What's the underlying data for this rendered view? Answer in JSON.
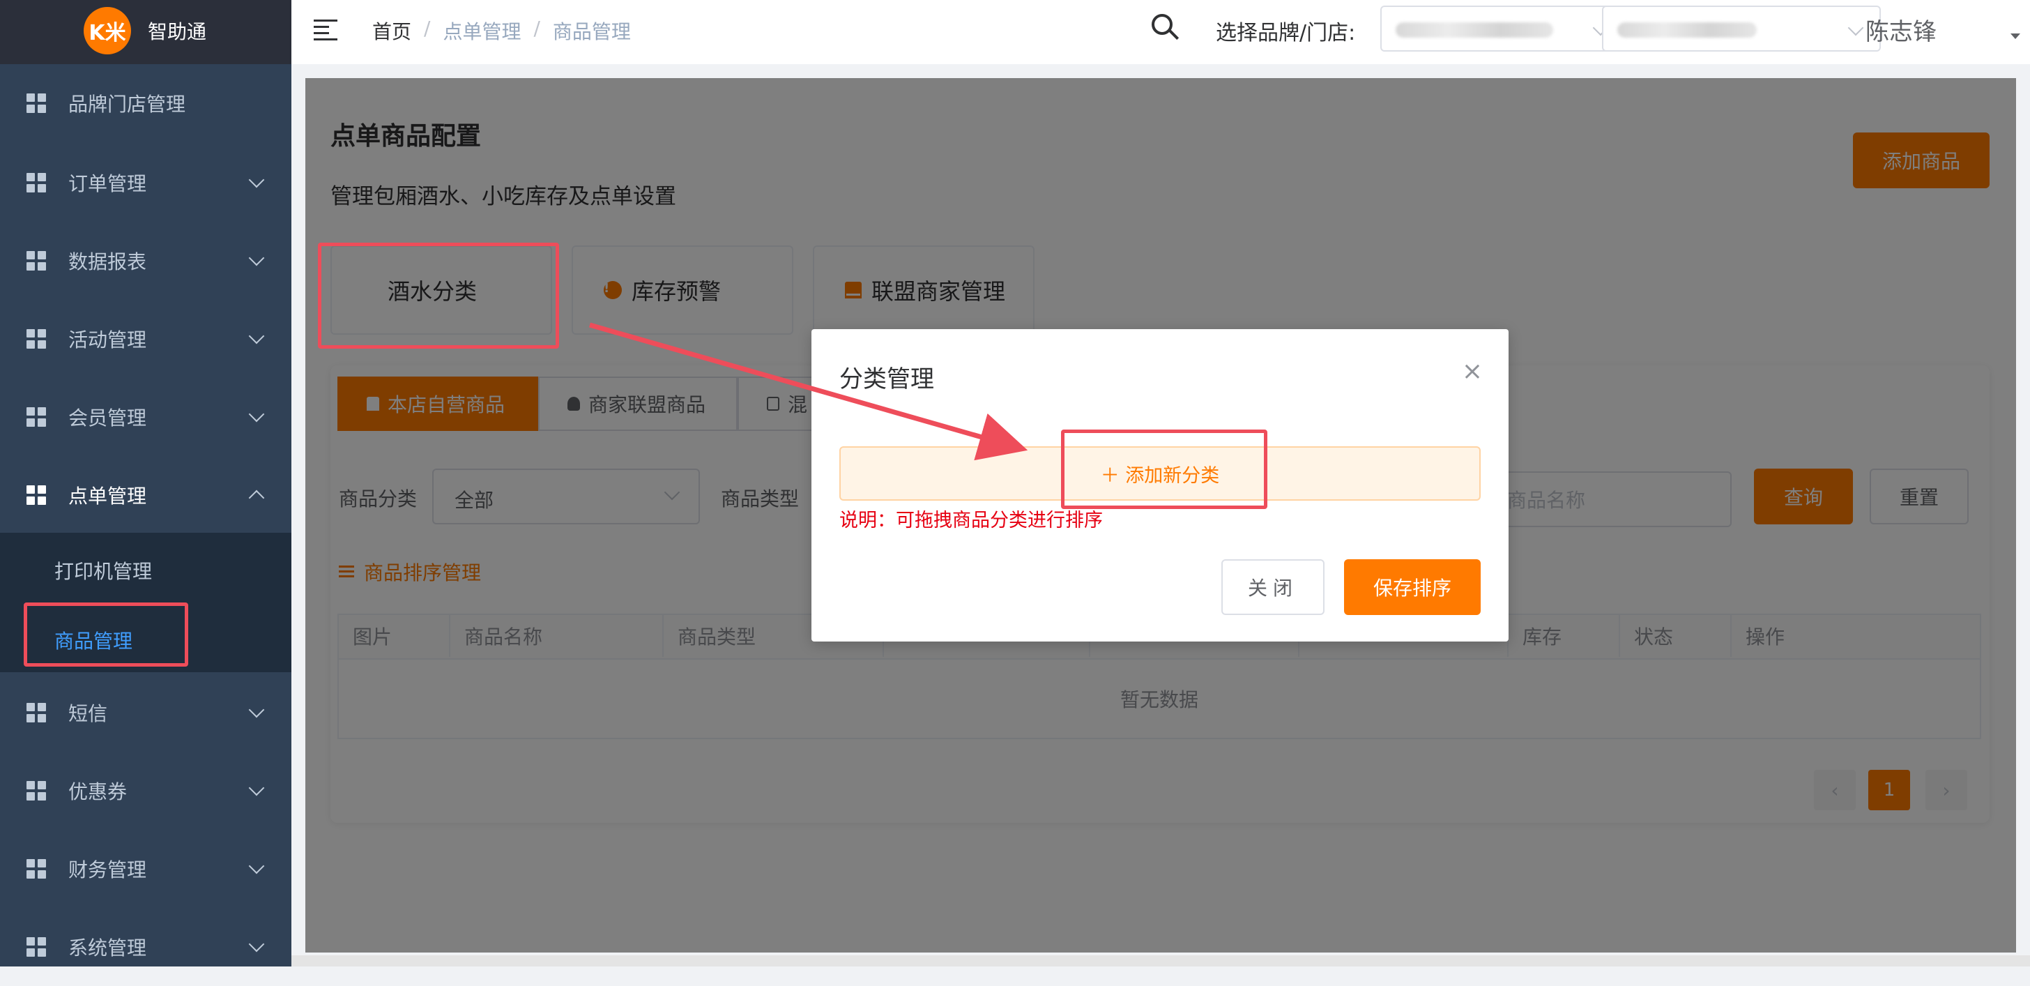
{
  "app": {
    "logo_text": "K米",
    "name": "智助通"
  },
  "sidebar": {
    "items": [
      {
        "label": "品牌门店管理",
        "has_children": false
      },
      {
        "label": "订单管理",
        "has_children": true
      },
      {
        "label": "数据报表",
        "has_children": true
      },
      {
        "label": "活动管理",
        "has_children": true
      },
      {
        "label": "会员管理",
        "has_children": true
      },
      {
        "label": "点单管理",
        "has_children": true,
        "expanded": true
      },
      {
        "label": "短信",
        "has_children": true
      },
      {
        "label": "优惠券",
        "has_children": true
      },
      {
        "label": "财务管理",
        "has_children": true
      },
      {
        "label": "系统管理",
        "has_children": true
      }
    ],
    "submenu": [
      {
        "label": "打印机管理",
        "active": false
      },
      {
        "label": "商品管理",
        "active": true
      }
    ]
  },
  "header": {
    "breadcrumb": [
      "首页",
      "点单管理",
      "商品管理"
    ],
    "breadcrumb_sep": "/",
    "brand_store_label": "选择品牌/门店:",
    "username": "陈志锋"
  },
  "page": {
    "title": "点单商品配置",
    "subtitle": "管理包厢酒水、小吃库存及点单设置",
    "add_goods_button": "添加商品",
    "feature_cards": [
      "酒水分类",
      "库存预警",
      "联盟商家管理"
    ],
    "tabs": [
      "本店自营商品",
      "商家联盟商品",
      "混"
    ],
    "filters": {
      "category_label": "商品分类",
      "category_value": "全部",
      "type_label": "商品类型",
      "name_placeholder": "商品名称",
      "query_button": "查询",
      "reset_button": "重置"
    },
    "sort_link": "商品排序管理",
    "table": {
      "columns": [
        "图片",
        "商品名称",
        "商品类型",
        "",
        "",
        "",
        "库存",
        "状态",
        "操作"
      ],
      "empty_text": "暂无数据"
    },
    "pagination": {
      "prev": "‹",
      "current": "1",
      "next": "›"
    }
  },
  "dialog": {
    "title": "分类管理",
    "close_symbol": "×",
    "add_category_button": "＋ 添加新分类",
    "note": "说明：可拖拽商品分类进行排序",
    "close_button": "关闭",
    "save_button": "保存排序"
  },
  "colors": {
    "primary": "#ff7a00",
    "sidebar_bg": "#304156",
    "highlight_annotation": "#ee4d5a",
    "note_red": "#e60012"
  }
}
